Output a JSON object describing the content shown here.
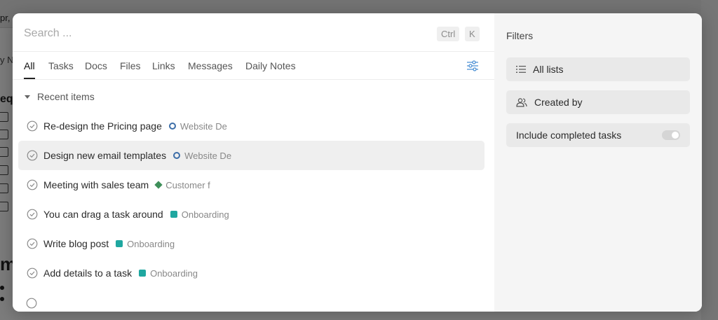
{
  "background": {
    "left_text_1": "pr,",
    "left_text_2": "y N",
    "left_heading": "eq",
    "left_big": "m"
  },
  "search": {
    "placeholder": "Search ...",
    "value": "",
    "shortcut_keys": [
      "Ctrl",
      "K"
    ]
  },
  "tabs": [
    {
      "label": "All",
      "active": true
    },
    {
      "label": "Tasks",
      "active": false
    },
    {
      "label": "Docs",
      "active": false
    },
    {
      "label": "Files",
      "active": false
    },
    {
      "label": "Links",
      "active": false
    },
    {
      "label": "Messages",
      "active": false
    },
    {
      "label": "Daily Notes",
      "active": false
    }
  ],
  "tab_settings_icon": "sliders-icon",
  "recent": {
    "header": "Recent items",
    "items": [
      {
        "title": "Re-design the Pricing page",
        "tag": "Website De",
        "tag_icon": "ring",
        "tag_color": "#3d6ea8"
      },
      {
        "title": "Design new email templates",
        "tag": "Website De",
        "tag_icon": "ring",
        "tag_color": "#3d6ea8",
        "hovered": true
      },
      {
        "title": "Meeting with sales team",
        "tag": "Customer f",
        "tag_icon": "diamond",
        "tag_color": "#3f8f5a"
      },
      {
        "title": "You can drag a task around",
        "tag": "Onboarding",
        "tag_icon": "square",
        "tag_color": "#1fa7a0"
      },
      {
        "title": "Write blog post",
        "tag": "Onboarding",
        "tag_icon": "square",
        "tag_color": "#1fa7a0"
      },
      {
        "title": "Add details to a task",
        "tag": "Onboarding",
        "tag_icon": "square",
        "tag_color": "#1fa7a0"
      }
    ]
  },
  "filters": {
    "title": "Filters",
    "all_lists": "All lists",
    "created_by": "Created by",
    "include_completed": "Include completed tasks",
    "include_completed_on": false
  }
}
